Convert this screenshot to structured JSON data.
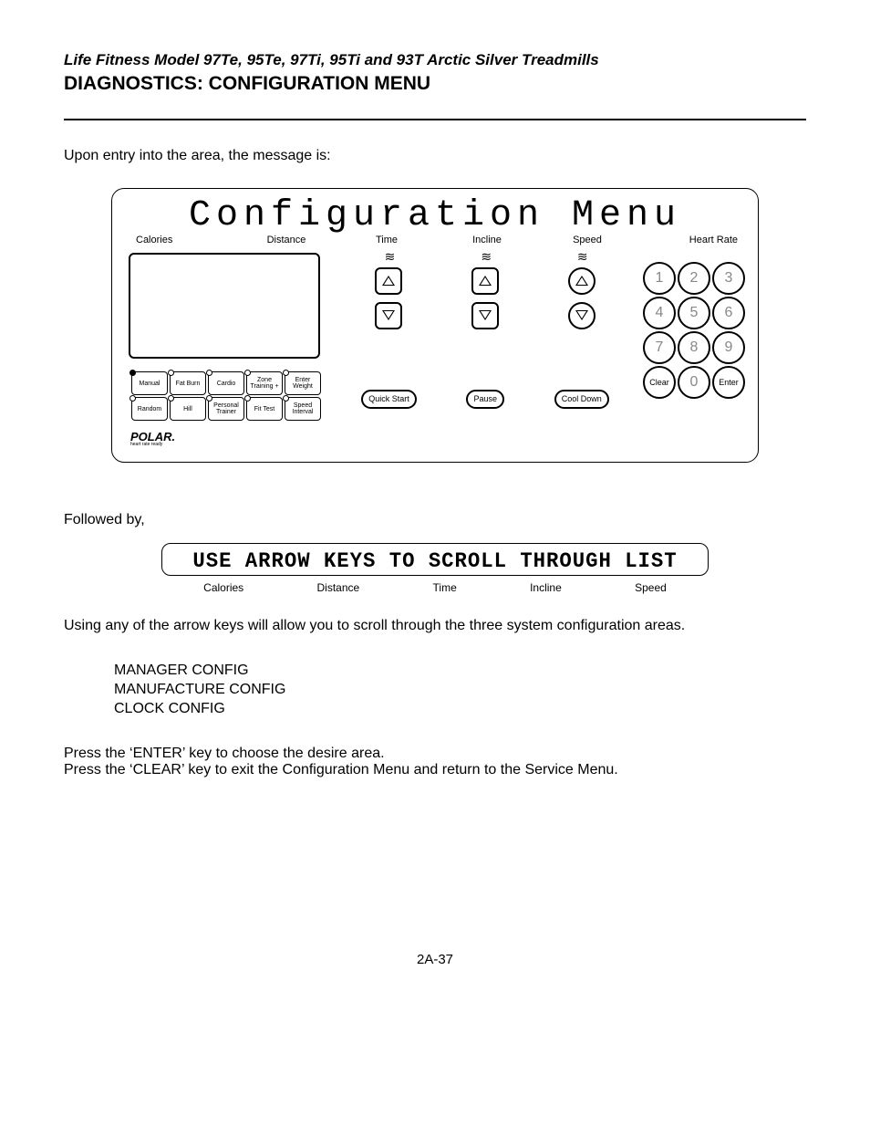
{
  "header": {
    "model_line": "Life Fitness Model 97Te, 95Te, 97Ti, 95Ti and 93T Arctic Silver Treadmills",
    "section_title": "DIAGNOSTICS: CONFIGURATION MENU"
  },
  "intro": "Upon entry into the area, the message is:",
  "console": {
    "display": "Configuration Menu",
    "columns": {
      "calories": "Calories",
      "distance": "Distance",
      "time": "Time",
      "incline": "Incline",
      "speed": "Speed",
      "hr": "Heart Rate"
    },
    "programs": {
      "row1": [
        "Manual",
        "Fat Burn",
        "Cardio",
        "Zone Training +",
        "Enter Weight"
      ],
      "row2": [
        "Random",
        "Hill",
        "Personal Trainer",
        "Fit Test",
        "Speed Interval"
      ]
    },
    "ovals": {
      "quick_start": "Quick Start",
      "pause": "Pause",
      "cool_down": "Cool Down"
    },
    "keypad": [
      "1",
      "2",
      "3",
      "4",
      "5",
      "6",
      "7",
      "8",
      "9",
      "Clear",
      "0",
      "Enter"
    ],
    "polar": "POLAR.",
    "polar_sub": "heart rate ready"
  },
  "followed_by": "Followed by,",
  "lcd": {
    "text": "USE ARROW KEYS TO SCROLL THROUGH LIST",
    "labels": [
      "Calories",
      "Distance",
      "Time",
      "Incline",
      "Speed"
    ]
  },
  "scroll_text": "Using any of the arrow keys will allow you to scroll through the three system configuration areas.",
  "configs": [
    "MANAGER CONFIG",
    "MANUFACTURE CONFIG",
    "CLOCK CONFIG"
  ],
  "press_enter": "Press the ‘ENTER’ key to choose the desire area.",
  "press_clear": "Press the ‘CLEAR’ key to exit the Configuration Menu and return to the Service Menu.",
  "page_num": "2A-37"
}
